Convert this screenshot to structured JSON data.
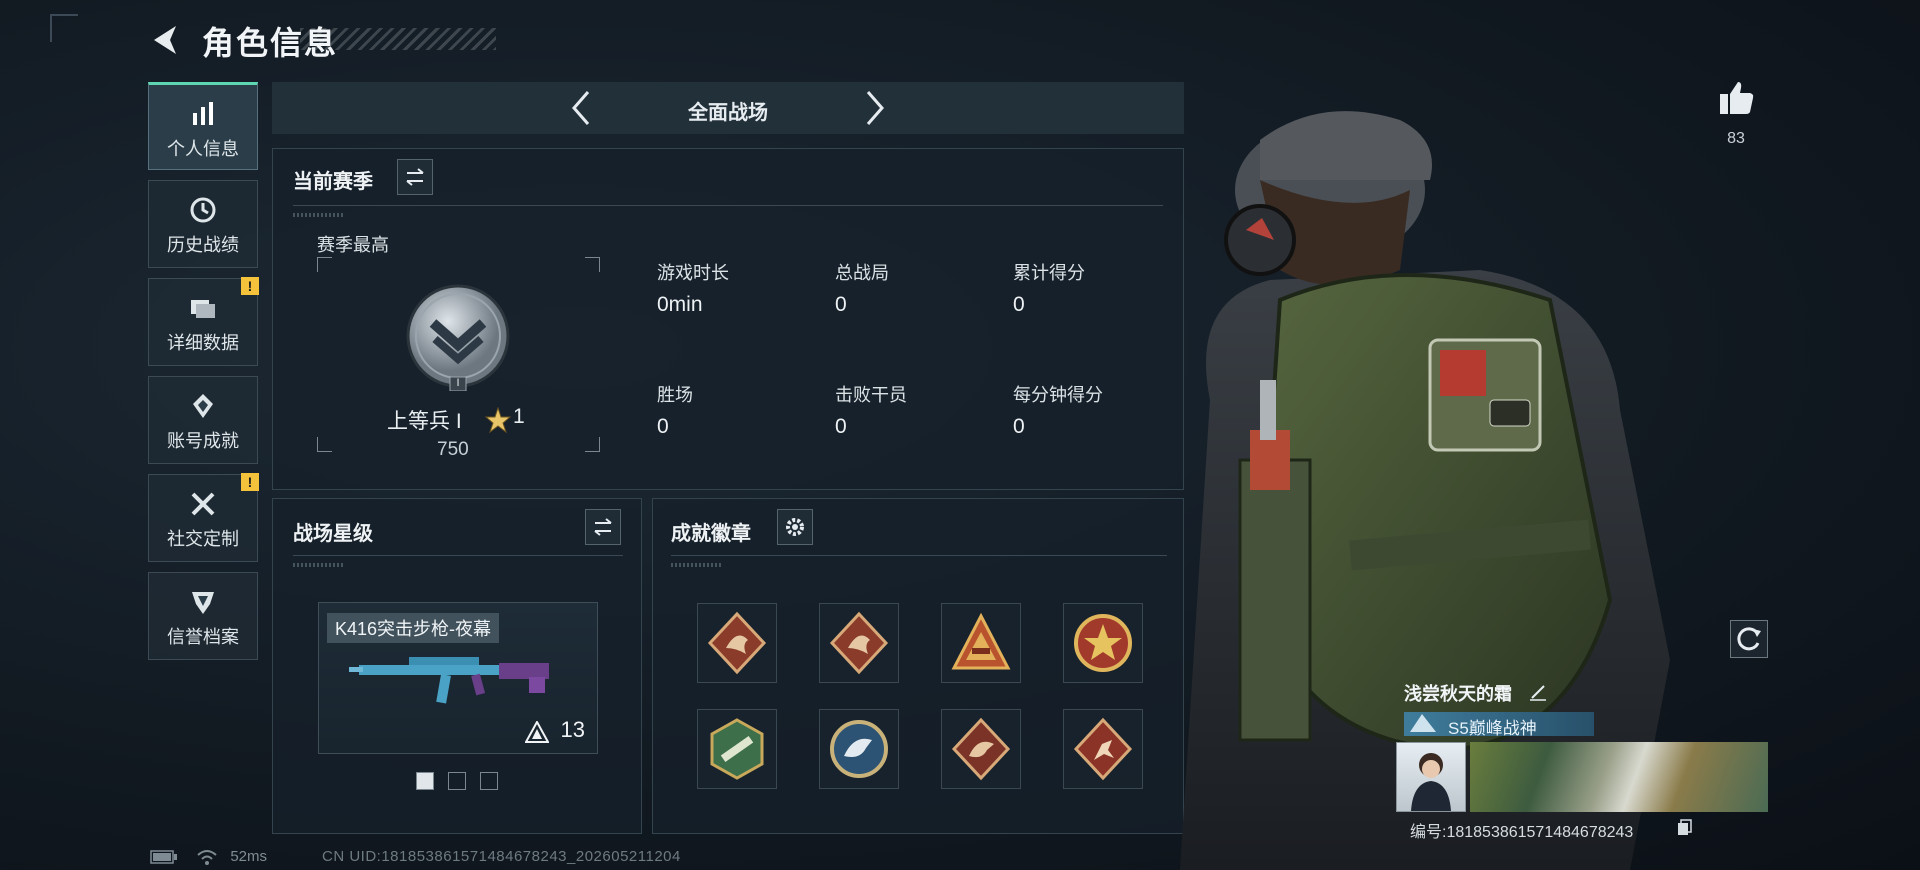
{
  "header": {
    "title": "角色信息"
  },
  "nav": {
    "items": [
      {
        "label": "个人信息",
        "icon": "bar-chart-icon",
        "active": true,
        "warning": false
      },
      {
        "label": "历史战绩",
        "icon": "clock-icon",
        "active": false,
        "warning": false
      },
      {
        "label": "详细数据",
        "icon": "folder-icon",
        "active": false,
        "warning": true
      },
      {
        "label": "账号成就",
        "icon": "medal-icon",
        "active": false,
        "warning": false
      },
      {
        "label": "社交定制",
        "icon": "tools-icon",
        "active": false,
        "warning": true
      },
      {
        "label": "信誉档案",
        "icon": "shield-icon",
        "active": false,
        "warning": false
      }
    ],
    "warning_mark": "!"
  },
  "mode": {
    "title": "全面战场"
  },
  "season": {
    "title": "当前赛季",
    "best_label": "赛季最高",
    "rank_name": "上等兵 I",
    "rank_stars": "1",
    "rank_score": "750",
    "rank_tier": "I",
    "stats": [
      {
        "label": "游戏时长",
        "value": "0min"
      },
      {
        "label": "总战局",
        "value": "0"
      },
      {
        "label": "累计得分",
        "value": "0"
      },
      {
        "label": "胜场",
        "value": "0"
      },
      {
        "label": "击败干员",
        "value": "0"
      },
      {
        "label": "每分钟得分",
        "value": "0"
      }
    ]
  },
  "star_level": {
    "title": "战场星级",
    "weapon_name": "K416突击步枪-夜幕",
    "weapon_level": "13",
    "pages": 3,
    "current_page": 1
  },
  "badges": {
    "title": "成就徽章",
    "items": [
      "dragon-badge-icon",
      "dragon-badge-icon",
      "pyramid-badge-icon",
      "star-badge-icon",
      "missile-badge-icon",
      "wolf-badge-icon",
      "wolf-badge-icon",
      "runner-badge-icon"
    ]
  },
  "likes": {
    "count": "83"
  },
  "player": {
    "name": "浅尝秋天的霜",
    "title": "S5巅峰战神",
    "id_label": "编号:181853861571484678243"
  },
  "status": {
    "ping": "52ms",
    "uid": "CN UID:181853861571484678243_202605211204"
  },
  "colors": {
    "accent": "#5ed6b2",
    "warning": "#f5c23c",
    "panel": "#16202a"
  }
}
